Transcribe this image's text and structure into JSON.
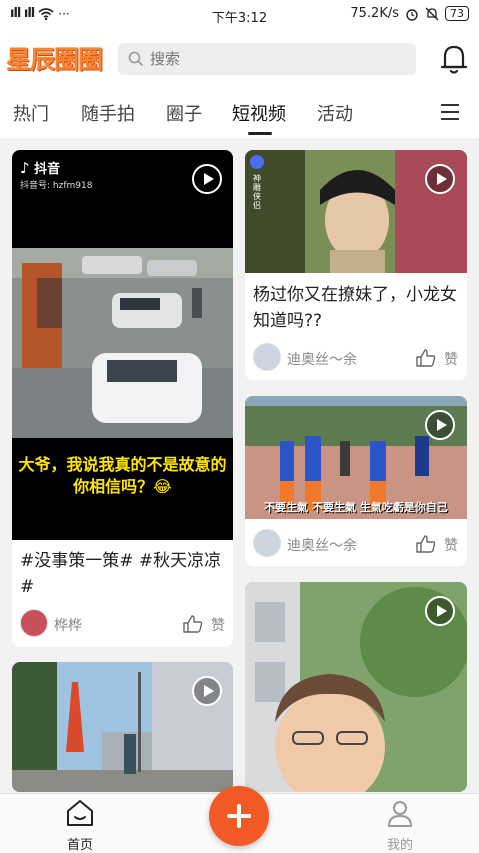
{
  "status_bar": {
    "signal": "ıll ıll",
    "time": "下午3:12",
    "speed": "75.2K/s",
    "battery": "73"
  },
  "header": {
    "logo": "星辰圈圈",
    "search_placeholder": "搜索"
  },
  "tabs": [
    {
      "label": "热门",
      "active": false
    },
    {
      "label": "随手拍",
      "active": false
    },
    {
      "label": "圈子",
      "active": false
    },
    {
      "label": "短视频",
      "active": true
    },
    {
      "label": "活动",
      "active": false
    }
  ],
  "feed": {
    "card1": {
      "douyin_brand": "抖音",
      "douyin_id": "抖音号: hzfm918",
      "subtitle": "大爷，我说我真的不是故意的\n你相信吗？😂",
      "title": "#没事策一策# #秋天凉凉#",
      "user": "桦桦",
      "like_label": "赞"
    },
    "card2": {
      "badge": "神雕侠侣",
      "title": "杨过你又在撩妹了，小龙女知道吗??",
      "user": "迪奥丝～余",
      "like_label": "赞"
    },
    "card3": {
      "subtitle": "不要生氣 不要生氣 生氣吃虧是你自己",
      "user": "迪奥丝～余",
      "like_label": "赞"
    }
  },
  "bottom_nav": {
    "home": "首页",
    "me": "我的"
  },
  "colors": {
    "accent": "#f15a24",
    "logo": "#f5862b"
  }
}
